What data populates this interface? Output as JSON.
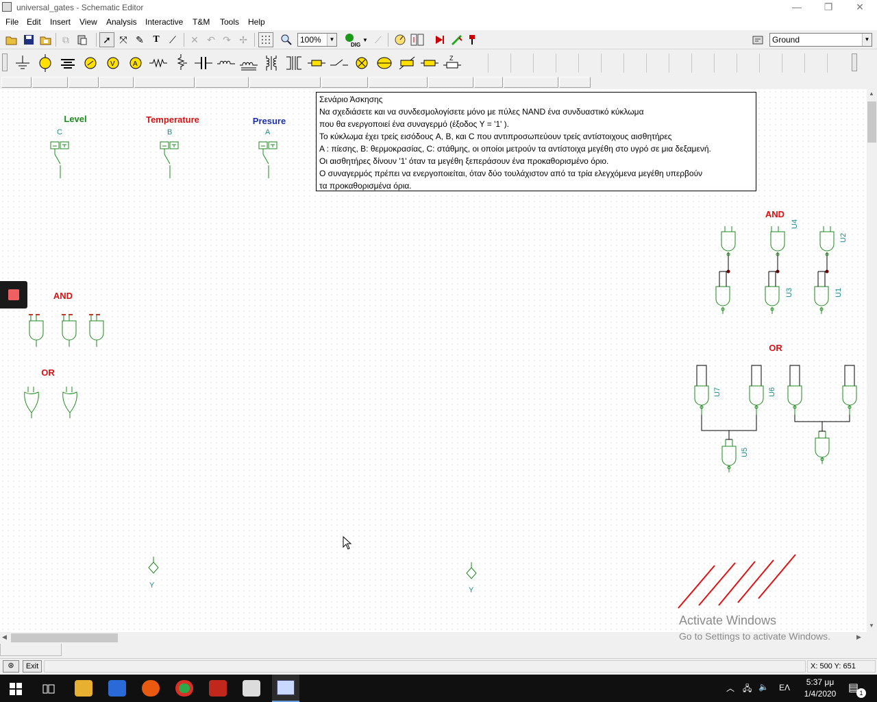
{
  "window": {
    "title": "universal_gates - Schematic Editor",
    "minimize_glyph": "—",
    "restore_glyph": "❐",
    "close_glyph": "✕"
  },
  "menu": {
    "items": [
      "File",
      "Edit",
      "Insert",
      "View",
      "Analysis",
      "Interactive",
      "T&M",
      "Tools",
      "Help"
    ]
  },
  "toolbar": {
    "zoom_value": "100%",
    "dig_label": "DIG",
    "ground_value": "Ground",
    "text_tool_glyph": "T"
  },
  "canvas": {
    "switches": [
      {
        "label": "Level",
        "color": "green",
        "pin": "C"
      },
      {
        "label": "Temperature",
        "color": "red",
        "pin": "B"
      },
      {
        "label": "Presure",
        "color": "blue",
        "pin": "A"
      }
    ],
    "left_and_label": "AND",
    "left_or_label": "OR",
    "right_and_label": "AND",
    "right_or_label": "OR",
    "gate_refs": {
      "u1": "U1",
      "u2": "U2",
      "u3": "U3",
      "u4": "U4",
      "u5": "U5",
      "u6": "U6",
      "u7": "U7"
    },
    "outputs": [
      {
        "label": "Y"
      },
      {
        "label": "Y"
      }
    ],
    "scenario_lines": [
      "Σενάριο Άσκησης",
      "Να σχεδιάσετε και να συνδεσμολογίσετε μόνο με πύλες NAND ένα συνδυαστικό κύκλωμα",
      "που θα ενεργοποιεί ένα συναγερμό (έξοδος Y = '1' ).",
      "Το κύκλωμα έχει τρείς εισόδους A, B, και C που αντιπροσωπεύουν τρείς αντίστοιχους αισθητήρες",
      "A : πίεσης, B: θερμοκρασίας,  C: στάθμης, οι οποίοι μετρούν τα αντίστοιχα μεγέθη στο υγρό  σε μια δεξαμενή.",
      "Οι αισθητήρες δίνουν '1' όταν τα μεγέθη ξεπεράσουν ένα προκαθορισμένο όριο.",
      "Ο συναγερμός πρέπει να ενεργοποιείται, όταν δύο τουλάχιστον από τα τρία ελεγχόμενα μεγέθη υπερβούν",
      "τα προκαθορισμένα όρια."
    ]
  },
  "watermark": {
    "line1": "Activate Windows",
    "line2": "Go to Settings to activate Windows."
  },
  "statusbar": {
    "exit_label": "Exit",
    "coords": "X: 500 Y: 651"
  },
  "taskbar": {
    "time": "5:37 μμ",
    "date": "1/4/2020",
    "lang": "ΕΛ",
    "notif_count": "1"
  },
  "colors": {
    "gate_stroke": "#1b8a1b",
    "wire": "#000000",
    "label_red": "#d81010",
    "label_blue": "#1c2fae",
    "label_green": "#1b8a1b",
    "annotation_red": "#e01010",
    "stop_button": "#f06060"
  }
}
